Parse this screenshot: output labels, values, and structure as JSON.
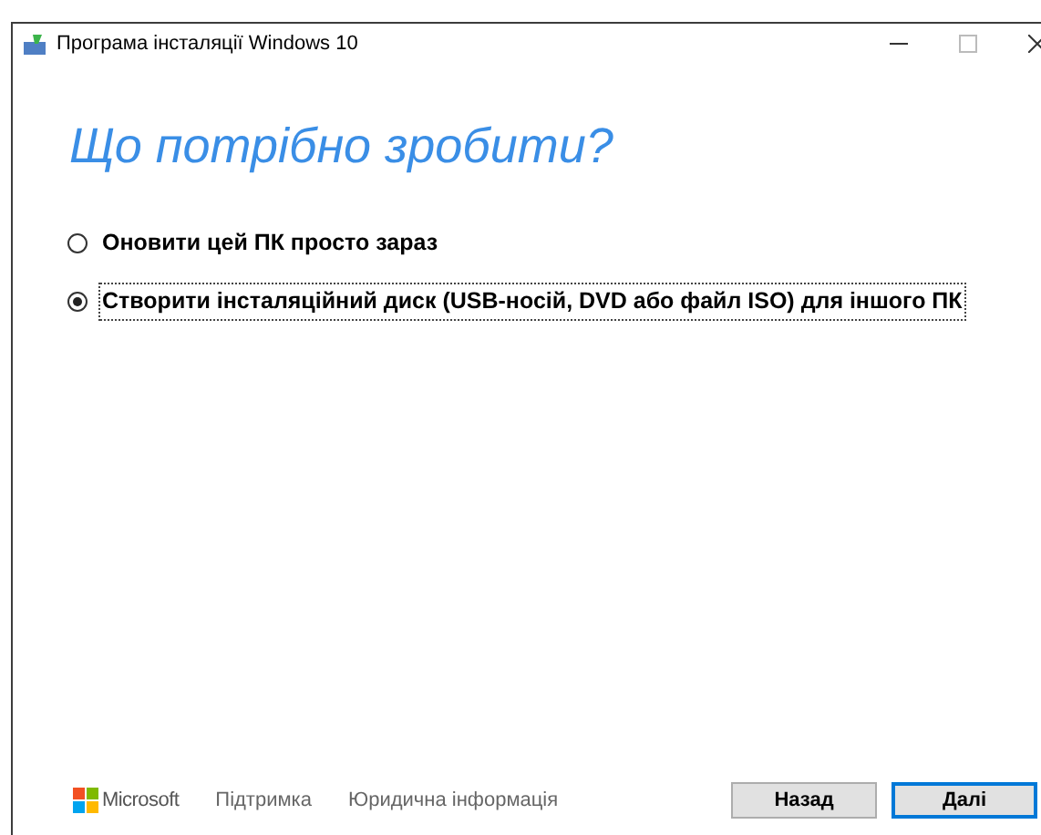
{
  "window": {
    "title": "Програма інсталяції Windows 10"
  },
  "heading": "Що потрібно зробити?",
  "options": [
    {
      "label": "Оновити цей ПК просто зараз",
      "selected": false
    },
    {
      "label": "Створити інсталяційний диск (USB-носій, DVD або файл ISO) для іншого ПК",
      "selected": true
    }
  ],
  "footer": {
    "brand": "Microsoft",
    "links": [
      "Підтримка",
      "Юридична інформація"
    ]
  },
  "buttons": [
    {
      "label": "Назад",
      "default": false
    },
    {
      "label": "Далі",
      "default": true
    }
  ]
}
